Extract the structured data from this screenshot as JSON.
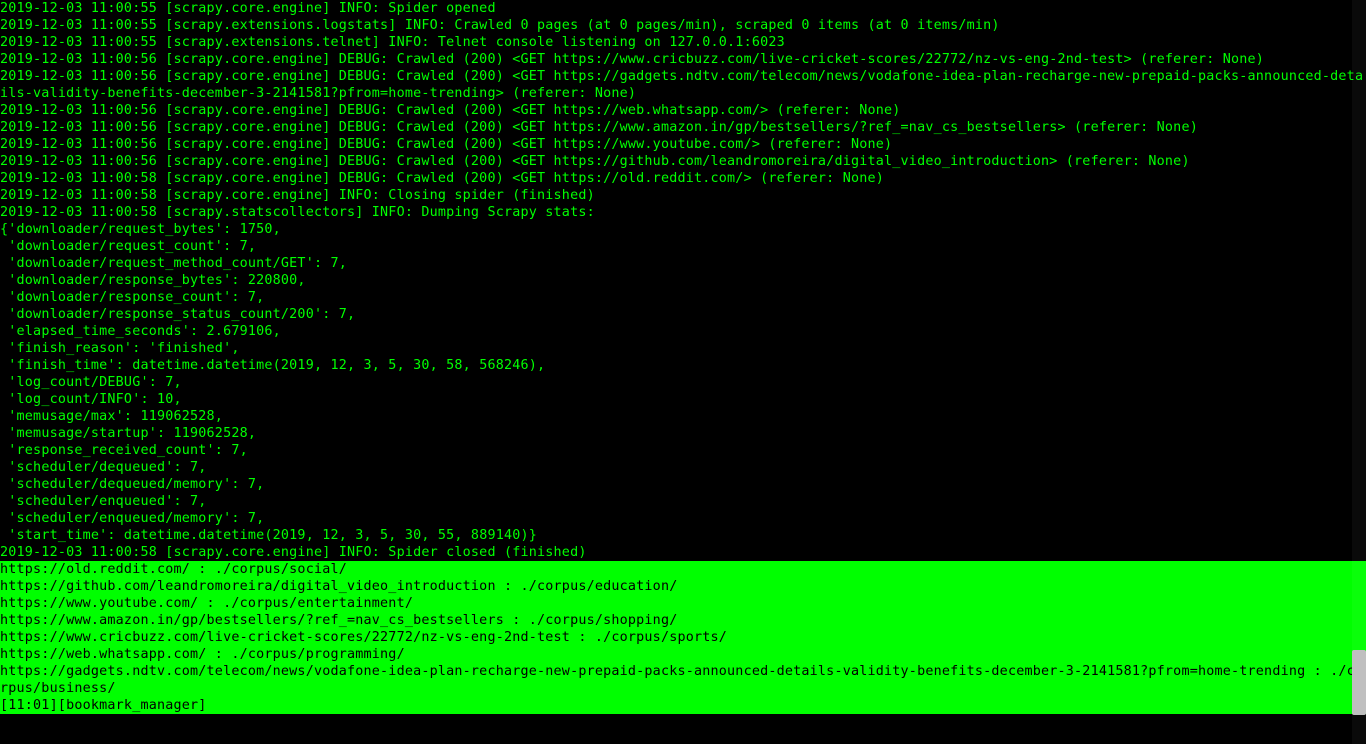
{
  "log_lines": [
    "2019-12-03 11:00:55 [scrapy.core.engine] INFO: Spider opened",
    "2019-12-03 11:00:55 [scrapy.extensions.logstats] INFO: Crawled 0 pages (at 0 pages/min), scraped 0 items (at 0 items/min)",
    "2019-12-03 11:00:55 [scrapy.extensions.telnet] INFO: Telnet console listening on 127.0.0.1:6023",
    "2019-12-03 11:00:56 [scrapy.core.engine] DEBUG: Crawled (200) <GET https://www.cricbuzz.com/live-cricket-scores/22772/nz-vs-eng-2nd-test> (referer: None)",
    "2019-12-03 11:00:56 [scrapy.core.engine] DEBUG: Crawled (200) <GET https://gadgets.ndtv.com/telecom/news/vodafone-idea-plan-recharge-new-prepaid-packs-announced-details-validity-benefits-december-3-2141581?pfrom=home-trending> (referer: None)",
    "2019-12-03 11:00:56 [scrapy.core.engine] DEBUG: Crawled (200) <GET https://web.whatsapp.com/> (referer: None)",
    "2019-12-03 11:00:56 [scrapy.core.engine] DEBUG: Crawled (200) <GET https://www.amazon.in/gp/bestsellers/?ref_=nav_cs_bestsellers> (referer: None)",
    "2019-12-03 11:00:56 [scrapy.core.engine] DEBUG: Crawled (200) <GET https://www.youtube.com/> (referer: None)",
    "2019-12-03 11:00:56 [scrapy.core.engine] DEBUG: Crawled (200) <GET https://github.com/leandromoreira/digital_video_introduction> (referer: None)",
    "2019-12-03 11:00:58 [scrapy.core.engine] DEBUG: Crawled (200) <GET https://old.reddit.com/> (referer: None)",
    "2019-12-03 11:00:58 [scrapy.core.engine] INFO: Closing spider (finished)",
    "2019-12-03 11:00:58 [scrapy.statscollectors] INFO: Dumping Scrapy stats:",
    "{'downloader/request_bytes': 1750,",
    " 'downloader/request_count': 7,",
    " 'downloader/request_method_count/GET': 7,",
    " 'downloader/response_bytes': 220800,",
    " 'downloader/response_count': 7,",
    " 'downloader/response_status_count/200': 7,",
    " 'elapsed_time_seconds': 2.679106,",
    " 'finish_reason': 'finished',",
    " 'finish_time': datetime.datetime(2019, 12, 3, 5, 30, 58, 568246),",
    " 'log_count/DEBUG': 7,",
    " 'log_count/INFO': 10,",
    " 'memusage/max': 119062528,",
    " 'memusage/startup': 119062528,",
    " 'response_received_count': 7,",
    " 'scheduler/dequeued': 7,",
    " 'scheduler/dequeued/memory': 7,",
    " 'scheduler/enqueued': 7,",
    " 'scheduler/enqueued/memory': 7,",
    " 'start_time': datetime.datetime(2019, 12, 3, 5, 30, 55, 889140)}",
    "2019-12-03 11:00:58 [scrapy.core.engine] INFO: Spider closed (finished)"
  ],
  "highlighted_lines": [
    "https://old.reddit.com/ : ./corpus/social/",
    "https://github.com/leandromoreira/digital_video_introduction : ./corpus/education/",
    "https://www.youtube.com/ : ./corpus/entertainment/",
    "https://www.amazon.in/gp/bestsellers/?ref_=nav_cs_bestsellers : ./corpus/shopping/",
    "https://www.cricbuzz.com/live-cricket-scores/22772/nz-vs-eng-2nd-test : ./corpus/sports/",
    "https://web.whatsapp.com/ : ./corpus/programming/",
    "https://gadgets.ndtv.com/telecom/news/vodafone-idea-plan-recharge-new-prepaid-packs-announced-details-validity-benefits-december-3-2141581?pfrom=home-trending : ./corpus/business/"
  ],
  "prompt": "[11:01][bookmark_manager] "
}
